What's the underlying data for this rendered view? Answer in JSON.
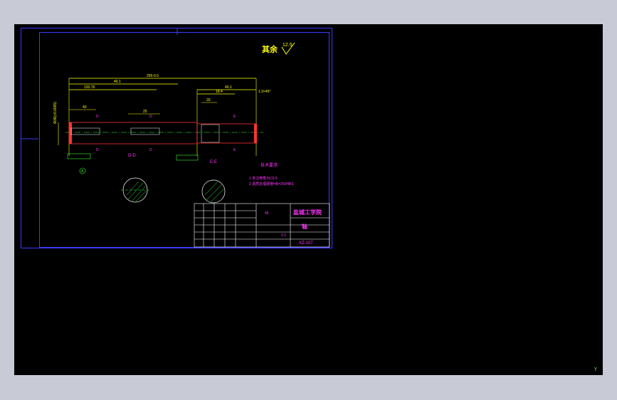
{
  "drawing": {
    "roughness_note": "其余",
    "roughness_value": "12.5",
    "overall_length": "255-0.5",
    "dim_40_1_left": "40.1",
    "dim_40_1_right": "40.1",
    "dim_120_76": "120.76",
    "dim_18_4": "18.4",
    "dim_40": "40",
    "dim_25": "25",
    "dim_20": "20",
    "chamfer_note": "1.3×45°",
    "diameter_left": "Φ36(±0.0065)",
    "section_dd": "D-D",
    "section_ee": "E-E",
    "tech_req_title": "技术要求:",
    "tech_req_1": "1.未注倒角为C0.5",
    "tech_req_2": "2.调质处理硬度HB=250HBS",
    "label_d": "D",
    "label_e": "E",
    "label_a": "A"
  },
  "title_block": {
    "school": "盐城工学院",
    "part_name": "轴",
    "drawing_no": "XZ-107",
    "material": "45",
    "scale": "1:1"
  },
  "colors": {
    "frame": "#3a3aff",
    "dimension": "#ffff00",
    "annotation": "#ff33ff",
    "centerline": "#33ff33",
    "part": "#ff3333",
    "hatch": "#33ff33",
    "table": "#ffffff"
  }
}
